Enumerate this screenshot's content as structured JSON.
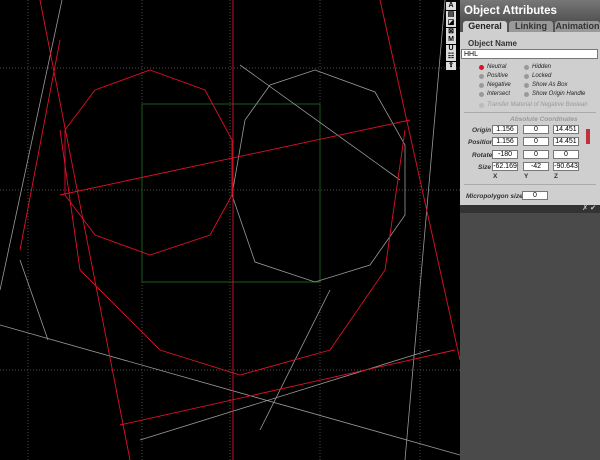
{
  "toolbar": {
    "icons": [
      "A",
      "▤",
      "◪",
      "⊠",
      "M",
      "U",
      "☷",
      "⇪"
    ]
  },
  "panel": {
    "title": "Object Attributes",
    "tabs": [
      "General",
      "Linking",
      "Animation"
    ],
    "object_name_label": "Object Name",
    "object_name": "HHL",
    "radios": [
      {
        "label": "Neutral",
        "selected": true
      },
      {
        "label": "Positive"
      },
      {
        "label": "Negative"
      },
      {
        "label": "Intersect"
      }
    ],
    "checks": [
      {
        "label": "Hidden"
      },
      {
        "label": "Locked"
      },
      {
        "label": "Show As Box"
      },
      {
        "label": "Show Origin Handle"
      }
    ],
    "transfer_label": "Transfer Material of Negative Boolean",
    "coords_label": "Absolute Coordinates",
    "rows": [
      {
        "label": "Origin",
        "x": "1.156",
        "y": "0",
        "z": "14.451"
      },
      {
        "label": "Position",
        "x": "1.156",
        "y": "0",
        "z": "14.451"
      },
      {
        "label": "Rotate",
        "x": "-180",
        "y": "0",
        "z": "0"
      },
      {
        "label": "Size",
        "x": "-62.169",
        "y": "-42",
        "z": "-90.643"
      }
    ],
    "axes": [
      "X",
      "Y",
      "Z"
    ],
    "micropolygon_label": "Micropolygon size",
    "micropolygon_value": "0",
    "cancel": "✗",
    "ok": "✔"
  },
  "colors": {
    "selection": "#e0102a",
    "wire": "#9a9a9a",
    "guide": "#1c5a1c"
  }
}
